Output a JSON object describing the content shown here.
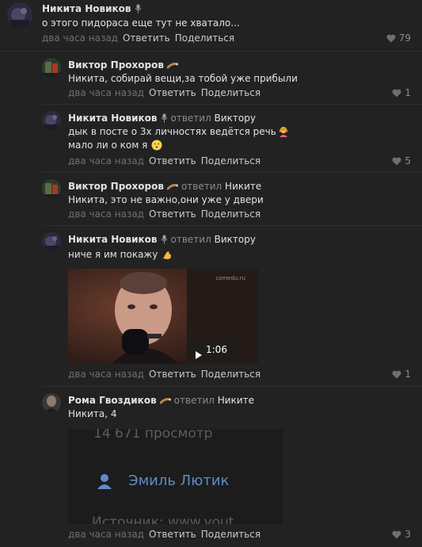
{
  "labels": {
    "time": "два часа назад",
    "reply": "Ответить",
    "share": "Поделиться",
    "replied": "ответил"
  },
  "comments": [
    {
      "author": "Никита Новиков",
      "text_lines": [
        "о этого пидораса еще тут не хватало..."
      ],
      "likes": "79"
    },
    {
      "author": "Виктор Прохоров",
      "text_lines": [
        "Никита, собирай вещи,за тобой уже прибыли"
      ],
      "likes": "1"
    },
    {
      "author": "Никита Новиков",
      "reply_to": "Виктору",
      "text_lines": [
        "дык в посте о 3х личностях ведётся речь",
        "мало ли о ком я"
      ],
      "likes": "5"
    },
    {
      "author": "Виктор Прохоров",
      "reply_to": "Никите",
      "text_lines": [
        "Никита, это не важно,они уже у двери"
      ],
      "likes": ""
    },
    {
      "author": "Никита Новиков",
      "reply_to": "Виктору",
      "text_lines": [
        "ниче я им покажу"
      ],
      "video": {
        "watermark": "comedu.ru",
        "duration": "1:06"
      },
      "likes": "1"
    },
    {
      "author": "Рома Гвоздиков",
      "reply_to": "Никите",
      "text_lines": [
        "Никита, 4"
      ],
      "image": {
        "line1": "14 671 просмотр",
        "line2": "Эмиль Лютик",
        "line3": "Источник: www.yout"
      },
      "likes": "3"
    }
  ],
  "colors": {
    "background": "#222222",
    "text": "#e1e3e6",
    "muted": "#6d6f73",
    "link_blue": "#5f8ac6"
  }
}
